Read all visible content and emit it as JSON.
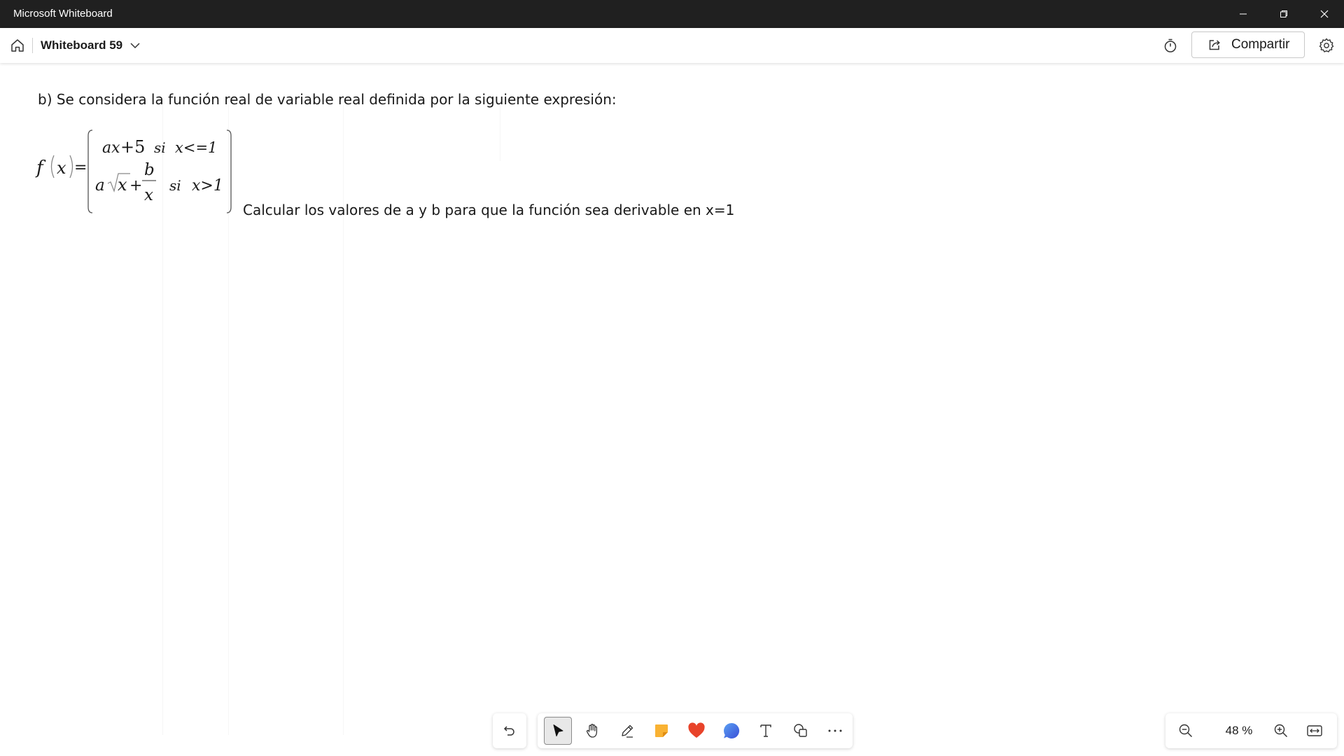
{
  "window": {
    "app_title": "Microsoft Whiteboard",
    "minimize_icon": "minimize-icon",
    "restore_icon": "restore-icon",
    "close_icon": "close-icon"
  },
  "header": {
    "home_icon": "home-icon",
    "board_title": "Whiteboard 59",
    "chevron_icon": "chevron-down-icon",
    "timer_icon": "timer-icon",
    "share_label": "Compartir",
    "share_icon": "share-icon",
    "settings_icon": "gear-icon"
  },
  "canvas": {
    "problem_text": "b) Se considera la función real de variable real definida por la siguiente expresión:",
    "formula": {
      "lhs_f": "f",
      "lhs_x": "x",
      "equals": "=",
      "case1_expr_a": "ax",
      "case1_expr_plus": "+5",
      "case1_si": "si",
      "case1_cond": "x<=1",
      "case2_a": "a",
      "case2_x": "x",
      "case2_plus": "+",
      "case2_num": "b",
      "case2_den": "x",
      "case2_si": "si",
      "case2_cond": "x>1"
    },
    "question_text": "Calcular los valores de a y b para que la función sea derivable en x=1"
  },
  "toolbar": {
    "undo_icon": "undo-icon",
    "tools": [
      {
        "name": "select-tool",
        "icon": "pointer-icon",
        "active": true
      },
      {
        "name": "pan-tool",
        "icon": "hand-icon",
        "active": false
      },
      {
        "name": "pen-tool",
        "icon": "pen-icon",
        "active": false
      },
      {
        "name": "sticky-note-tool",
        "icon": "sticky-note-icon",
        "active": false
      },
      {
        "name": "reactions-tool",
        "icon": "heart-icon",
        "active": false
      },
      {
        "name": "comment-tool",
        "icon": "comment-icon",
        "active": false
      },
      {
        "name": "text-tool",
        "icon": "text-icon",
        "active": false
      },
      {
        "name": "shapes-tool",
        "icon": "shapes-icon",
        "active": false
      },
      {
        "name": "more-tool",
        "icon": "more-icon",
        "active": false
      }
    ]
  },
  "zoom": {
    "level": "48 %",
    "zoom_out_icon": "zoom-out-icon",
    "zoom_in_icon": "zoom-in-icon",
    "fit_icon": "fit-screen-icon"
  },
  "colors": {
    "titlebar": "#202020",
    "sticky_note": "#f9b233",
    "heart": "#e8432a",
    "comment": "#3f7fe0"
  }
}
